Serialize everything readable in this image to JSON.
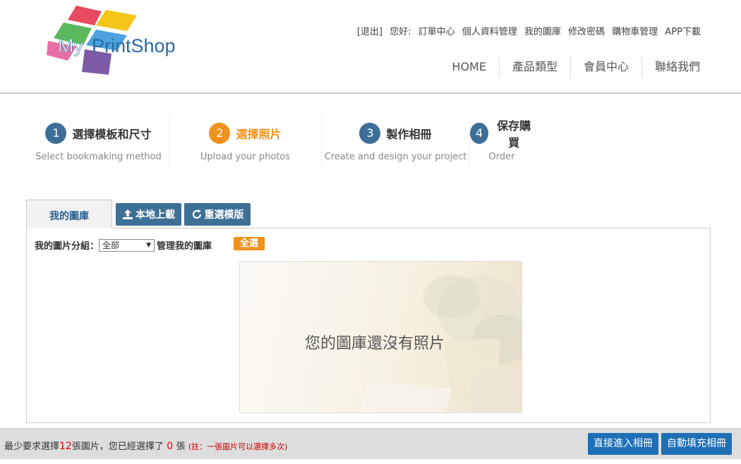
{
  "header": {
    "logo_text": "MyPrintShop",
    "top_links": [
      "[退出]",
      "您好:",
      "訂單中心",
      "個人資料管理",
      "我的圖庫",
      "修改密碼",
      "購物車管理",
      "APP下載"
    ],
    "nav": [
      "HOME",
      "產品類型",
      "會員中心",
      "聯絡我們"
    ]
  },
  "steps": [
    {
      "num": "1",
      "title": "選擇模板和尺寸",
      "sub": "Select bookmaking method"
    },
    {
      "num": "2",
      "title": "選擇照片",
      "sub": "Upload your photos"
    },
    {
      "num": "3",
      "title": "製作相冊",
      "sub": "Create and design your project"
    },
    {
      "num": "4",
      "title": "保存購買",
      "sub": "Order"
    }
  ],
  "tabs": {
    "gallery": "我的圖庫",
    "upload": "本地上載",
    "reselect": "重選模版"
  },
  "filter": {
    "label": "我的圖片分組：",
    "selected": "全部",
    "manage": "管理我的圖庫",
    "select_all": "全選"
  },
  "empty": {
    "message": "您的圖庫還沒有照片"
  },
  "bottom": {
    "text_a": "最少要求選擇",
    "min_count": "12",
    "text_b": "張圖片，您已經選擇了",
    "selected_count": " 0 ",
    "text_c": "張 ",
    "note": "(註：一張圖片可以選擇多次)",
    "btn_enter": "直接進入相冊",
    "btn_autofill": "自動填充相冊"
  },
  "colors": {
    "step_blue": "#3c6e97",
    "step_active_orange": "#f0921d",
    "tab_button_blue": "#3e6f95",
    "bottom_button_blue": "#1f6fb6"
  }
}
